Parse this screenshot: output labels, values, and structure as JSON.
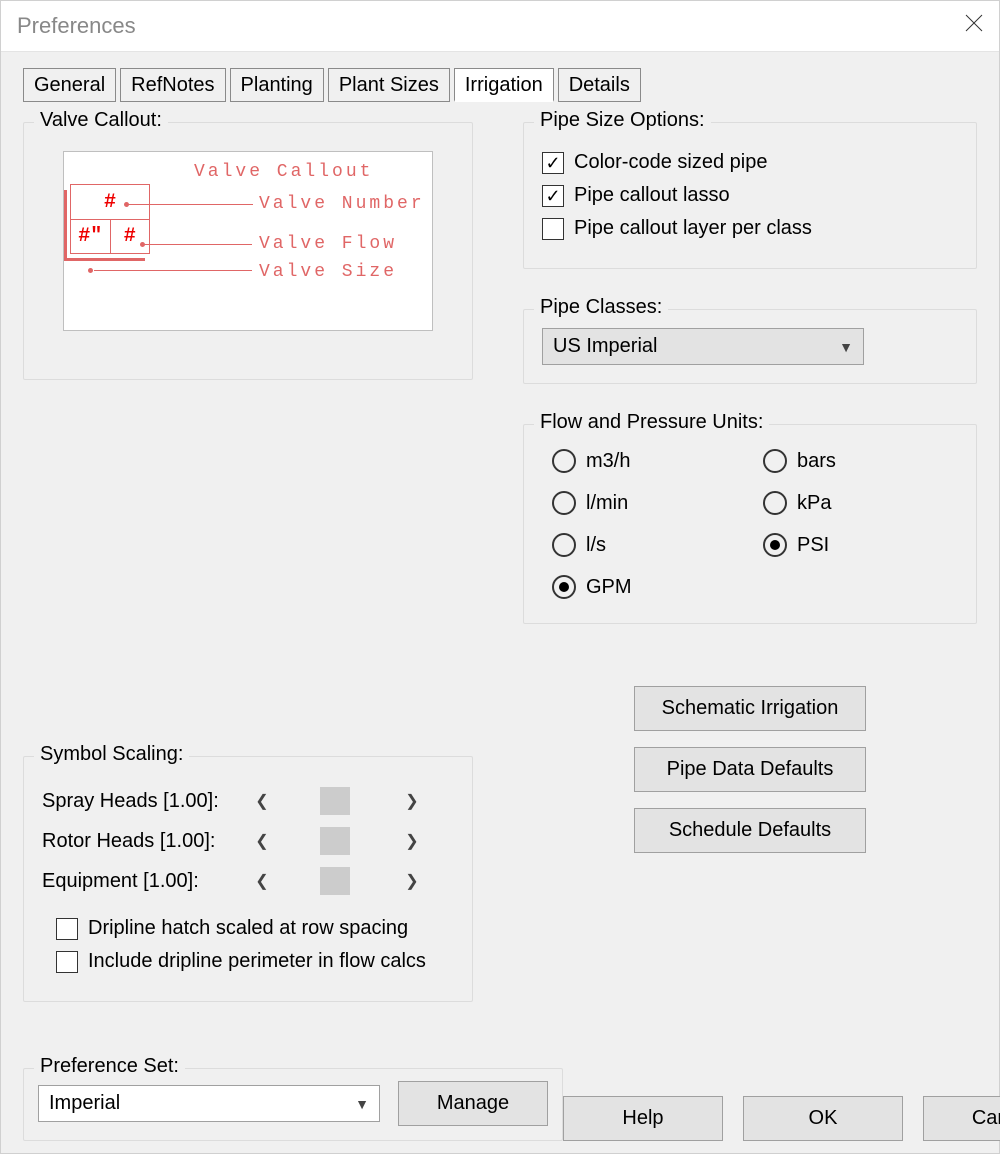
{
  "window": {
    "title": "Preferences"
  },
  "tabs": {
    "general": "General",
    "refnotes": "RefNotes",
    "planting": "Planting",
    "plant_sizes": "Plant Sizes",
    "irrigation": "Irrigation",
    "details": "Details",
    "active": "irrigation"
  },
  "valve_callout": {
    "legend": "Valve Callout:",
    "title": "Valve Callout",
    "label_number": "Valve Number",
    "label_flow": "Valve Flow",
    "label_size": "Valve Size",
    "box_top": "#",
    "box_bl": "#\"",
    "box_br": "#"
  },
  "pipe_size_options": {
    "legend": "Pipe Size Options:",
    "color_code": {
      "label": "Color-code sized pipe",
      "checked": true
    },
    "lasso": {
      "label": "Pipe callout lasso",
      "checked": true
    },
    "layer_per_class": {
      "label": "Pipe callout layer per class",
      "checked": false
    }
  },
  "pipe_classes": {
    "legend": "Pipe Classes:",
    "value": "US Imperial"
  },
  "flow_pressure": {
    "legend": "Flow and Pressure Units:",
    "m3h": {
      "label": "m3/h",
      "selected": false
    },
    "bars": {
      "label": "bars",
      "selected": false
    },
    "lmin": {
      "label": "l/min",
      "selected": false
    },
    "kpa": {
      "label": "kPa",
      "selected": false
    },
    "ls": {
      "label": "l/s",
      "selected": false
    },
    "psi": {
      "label": "PSI",
      "selected": true
    },
    "gpm": {
      "label": "GPM",
      "selected": true
    }
  },
  "symbol_scaling": {
    "legend": "Symbol Scaling:",
    "spray": "Spray Heads [1.00]:",
    "rotor": "Rotor Heads [1.00]:",
    "equipment": "Equipment [1.00]:",
    "dripline_hatch": {
      "label": "Dripline hatch scaled at row spacing",
      "checked": false
    },
    "dripline_perim": {
      "label": "Include dripline perimeter in flow calcs",
      "checked": false
    }
  },
  "buttons": {
    "schematic": "Schematic Irrigation",
    "pipe_defaults": "Pipe Data Defaults",
    "schedule_defaults": "Schedule Defaults",
    "manage": "Manage",
    "help": "Help",
    "ok": "OK",
    "cancel": "Cancel"
  },
  "preference_set": {
    "legend": "Preference Set:",
    "value": "Imperial"
  }
}
